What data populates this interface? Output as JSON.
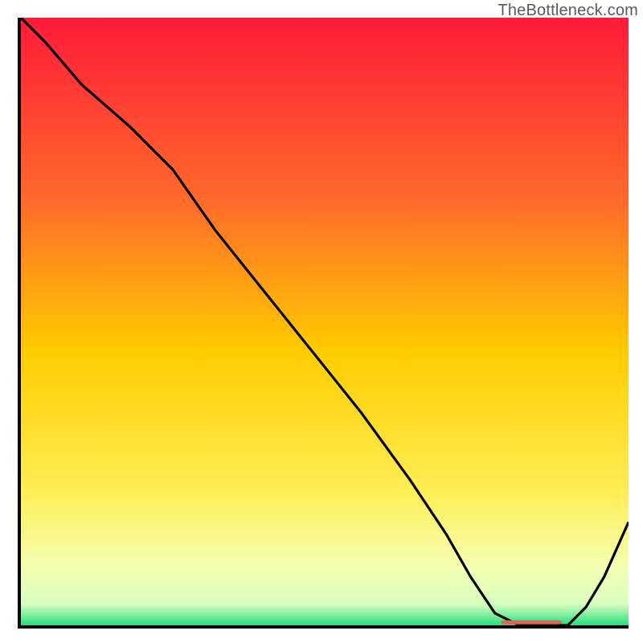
{
  "credit": "TheBottleneck.com",
  "chart_data": {
    "type": "line",
    "title": "",
    "xlabel": "",
    "ylabel": "",
    "xlim": [
      0,
      100
    ],
    "ylim": [
      0,
      100
    ],
    "background": {
      "type": "vertical-gradient",
      "stops": [
        {
          "pos": 0.0,
          "color": "#ff1a3a"
        },
        {
          "pos": 0.3,
          "color": "#ff6a2a"
        },
        {
          "pos": 0.55,
          "color": "#ffcc00"
        },
        {
          "pos": 0.78,
          "color": "#ffee55"
        },
        {
          "pos": 0.9,
          "color": "#f6ffb0"
        },
        {
          "pos": 0.965,
          "color": "#d8ffc0"
        },
        {
          "pos": 1.0,
          "color": "#23e07a"
        }
      ]
    },
    "series": [
      {
        "name": "bottleneck-curve",
        "color": "#000000",
        "x": [
          0,
          4,
          10,
          18,
          25,
          32,
          40,
          48,
          56,
          64,
          70,
          74,
          78,
          82,
          86,
          90,
          93,
          96,
          100
        ],
        "y": [
          100,
          96,
          89,
          82,
          75,
          65,
          55,
          45,
          35,
          24,
          15,
          8,
          2,
          0,
          0,
          0,
          3,
          8,
          17
        ]
      }
    ],
    "marker": {
      "name": "optimal-range",
      "color": "#d66a5a",
      "x_start": 79,
      "x_end": 89,
      "y": 0.5,
      "thickness": 5
    }
  }
}
